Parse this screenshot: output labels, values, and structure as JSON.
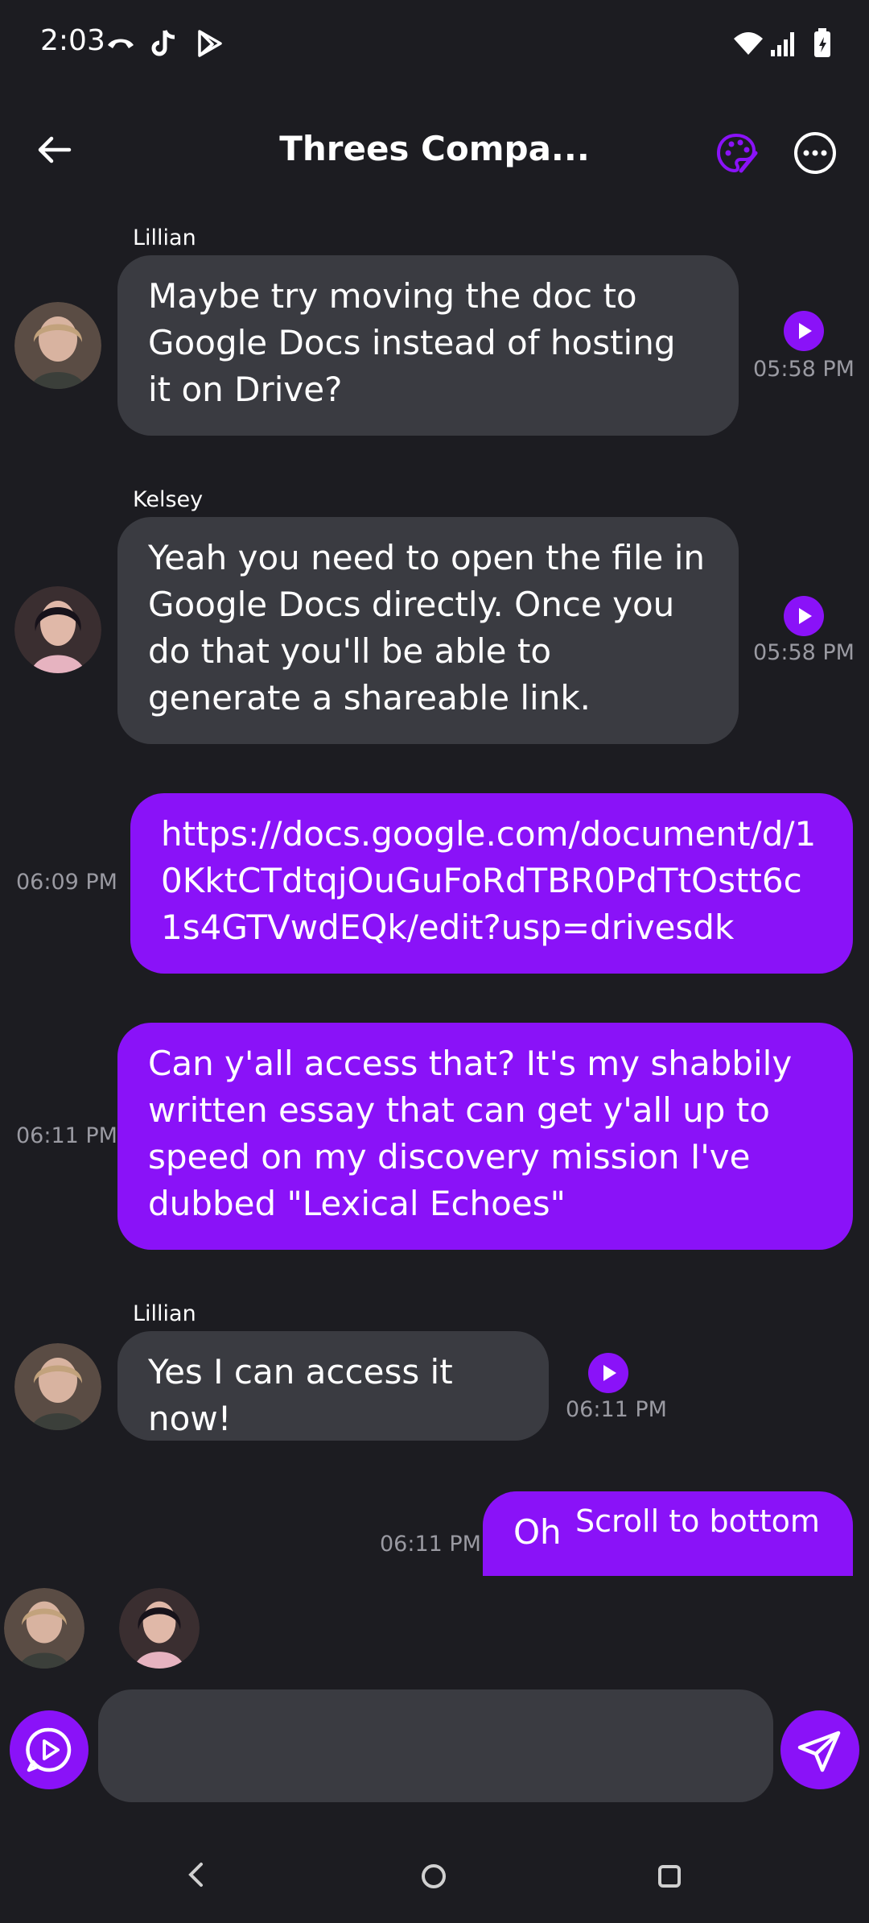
{
  "status_bar": {
    "time": "2:03"
  },
  "header": {
    "title": "Threes Compa..."
  },
  "messages": [
    {
      "sender": "Lillian",
      "text": "Maybe try moving the doc to Google Docs instead of hosting it on Drive?",
      "time": "05:58 PM"
    },
    {
      "sender": "Kelsey",
      "text": "Yeah you need to open the file in Google Docs directly. Once you do that you'll be able to generate a shareable link.",
      "time": "05:58 PM"
    },
    {
      "text": "https://docs.google.com/document/d/10KktCTdtqjOuGuFoRdTBR0PdTtOstt6c1s4GTVwdEQk/edit?usp=drivesdk",
      "time": "06:09 PM"
    },
    {
      "text": "Can y'all access that? It's my shabbily written essay that can get y'all up to speed on my discovery mission I've dubbed \"Lexical Echoes\"",
      "time": "06:11 PM"
    },
    {
      "sender": "Lillian",
      "text": "Yes I can access it now!",
      "time": "06:11 PM"
    },
    {
      "text": "Oh",
      "time": "06:11 PM"
    }
  ],
  "scroll_to_bottom": "Scroll to bottom",
  "colors": {
    "background": "#1c1c21",
    "incoming_bubble": "#3a3b41",
    "outgoing_bubble": "#8a12f8",
    "accent": "#8a12f8",
    "timestamp": "#9a9aa2"
  },
  "icons": [
    "back-arrow-icon",
    "palette-icon",
    "more-icon",
    "play-icon",
    "voice-icon",
    "send-icon"
  ]
}
